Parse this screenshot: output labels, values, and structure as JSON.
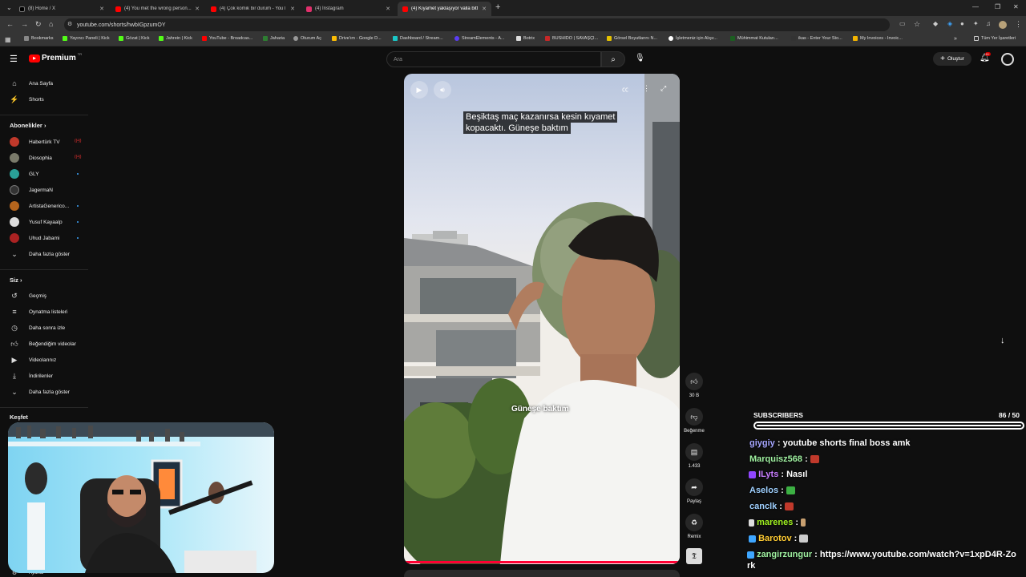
{
  "browser": {
    "tabs": [
      {
        "title": "(8) Home / X",
        "color": "#000000"
      },
      {
        "title": "(4) You met the wrong person...",
        "color": "#ff0000"
      },
      {
        "title": "(4) Çok komik bir durum - YouT",
        "color": "#ff0000"
      },
      {
        "title": "(4) Instagram",
        "color": "#e1306c"
      },
      {
        "title": "(4) Kıyamet yaklaşıyor valla bitt",
        "color": "#ff0000"
      }
    ],
    "url": "youtube.com/shorts/hwbIGpzumOY",
    "bookmarks": [
      {
        "label": "Bookmarks",
        "icon": "star-icon"
      },
      {
        "label": "Yayıncı Paneli | Kick",
        "icon": "kick-icon"
      },
      {
        "label": "Gözat | Kick",
        "icon": "kick-icon"
      },
      {
        "label": "Jahrein | Kick",
        "icon": "kick-icon"
      },
      {
        "label": "YouTube - Broadcas...",
        "icon": "youtube-icon"
      },
      {
        "label": "Jaharia",
        "icon": "leaf-icon"
      },
      {
        "label": "Oturum Aç",
        "icon": "globe-icon"
      },
      {
        "label": "Drive'ım - Google D...",
        "icon": "drive-icon"
      },
      {
        "label": "Dashboard / Stream...",
        "icon": "streamelements-icon"
      },
      {
        "label": "StreamElements - A...",
        "icon": "streamelements-icon"
      },
      {
        "label": "Botrix",
        "icon": "botrix-icon"
      },
      {
        "label": "BUSHIDO | SAVAŞÇI...",
        "icon": "bushido-icon"
      },
      {
        "label": "Görsel Boyutlarını N...",
        "icon": "star-icon"
      },
      {
        "label": "İşletmeniz için Alışv...",
        "icon": "google-icon"
      },
      {
        "label": "Mühimmat Kutuları...",
        "icon": "box-icon"
      },
      {
        "label": "ikas - Enter Your Sto...",
        "icon": "ikas-icon"
      },
      {
        "label": "My Invoices - Invoic...",
        "icon": "invoice-icon"
      },
      {
        "label": "Tüm Yer İşaretleri",
        "icon": "folder-icon"
      }
    ]
  },
  "youtube": {
    "logo_text": "Premium",
    "logo_superscript": "TR",
    "search_placeholder": "Ara",
    "create_label": "Oluştur",
    "notification_count": "9+"
  },
  "sidebar": {
    "main": [
      {
        "label": "Ana Sayfa",
        "icon": "home-icon"
      },
      {
        "label": "Shorts",
        "icon": "shorts-icon"
      }
    ],
    "subscriptions_title": "Abonelikler",
    "subscriptions": [
      {
        "label": "Habertürk TV",
        "color": "#c0392b",
        "live": true
      },
      {
        "label": "Diosophia",
        "color": "#7a7a6a",
        "live": true
      },
      {
        "label": "GLY",
        "color": "#2aa198",
        "live": false
      },
      {
        "label": "JagermaN",
        "color": "#333333",
        "live": false
      },
      {
        "label": "ArtistaGenerico...",
        "color": "#b5651d",
        "live": false
      },
      {
        "label": "Yusuf Kayaalp",
        "color": "#dddddd",
        "live": false
      },
      {
        "label": "Uhud Jabami",
        "color": "#aa2222",
        "live": false
      }
    ],
    "show_more_subs": "Daha fazla göster",
    "you_title": "Siz",
    "you": [
      {
        "label": "Geçmiş",
        "icon": "history-icon"
      },
      {
        "label": "Oynatma listeleri",
        "icon": "playlist-icon"
      },
      {
        "label": "Daha sonra izle",
        "icon": "clock-icon"
      },
      {
        "label": "Beğendiğim videolar",
        "icon": "thumbs-up-icon"
      },
      {
        "label": "Videolarınız",
        "icon": "video-icon"
      },
      {
        "label": "İndirilenler",
        "icon": "download-icon"
      },
      {
        "label": "Daha fazla göster",
        "icon": "chevron-down-icon"
      }
    ],
    "explore_title": "Keşfet",
    "settings_label": "Ayarlar"
  },
  "video": {
    "caption_top_line1": "Beşiktaş maç kazanırsa kesin kıyamet",
    "caption_top_line2": "kopacaktı. Güneşe baktım",
    "caption_mid": "Güneşe baktım"
  },
  "actions": {
    "likes": "30 B",
    "dislike_label": "Beğenme",
    "comments": "1.433",
    "share_label": "Paylaş",
    "remix_label": "Remix"
  },
  "overlay": {
    "subscribers_label": "SUBSCRIBERS",
    "subscribers_count": "86 / 50",
    "subscribers_current": 86,
    "subscribers_goal": 50,
    "chat": [
      {
        "user": "giygiy",
        "color": "#a6a6ff",
        "message": "youtube shorts final boss amk",
        "badge": "",
        "emote": ""
      },
      {
        "user": "Marquisz568",
        "color": "#9ff0a0",
        "message": "",
        "badge": "",
        "emote": "#c0392b"
      },
      {
        "user": "ILyts",
        "color": "#c87dff",
        "message": "Nasıl",
        "badge": "#9146ff",
        "emote": ""
      },
      {
        "user": "Aselos",
        "color": "#9fd0ff",
        "message": "",
        "badge": "",
        "emote": "#3cb043"
      },
      {
        "user": "canclk",
        "color": "#9fd0ff",
        "message": "",
        "badge": "",
        "emote": "#c0392b"
      },
      {
        "user": "marenes",
        "color": "#9ff020",
        "message": "",
        "badge": "#dddddd",
        "emote": "#c8a070"
      },
      {
        "user": "Barotov",
        "color": "#ffcc33",
        "message": "",
        "badge": "#3ea6ff",
        "emote": "#cccccc"
      },
      {
        "user": "zangirzungur",
        "color": "#9ff0a0",
        "message": "https://www.youtube.com/watch?v=1xpD4R-Zork",
        "badge": "#3ea6ff",
        "emote": ""
      }
    ]
  }
}
